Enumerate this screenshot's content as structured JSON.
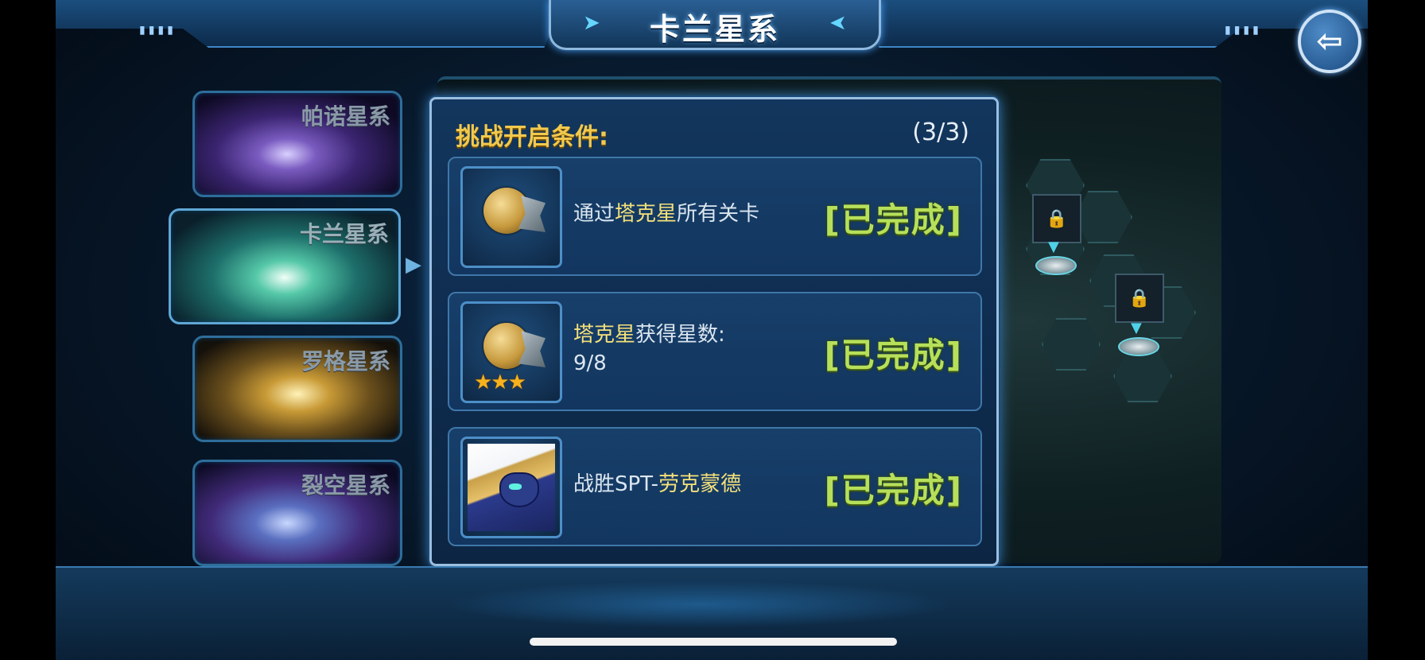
{
  "header": {
    "title": "卡兰星系"
  },
  "galaxies": [
    {
      "name": "帕诺星系"
    },
    {
      "name": "卡兰星系"
    },
    {
      "name": "罗格星系"
    },
    {
      "name": "裂空星系"
    }
  ],
  "dialog": {
    "title": "挑战开启条件:",
    "count": "(3/3)",
    "conditions": [
      {
        "prefix": "通过",
        "highlight": "塔克星",
        "suffix": "所有关卡",
        "status": "[已完成]",
        "icon": "planet-icon"
      },
      {
        "highlight": "塔克星",
        "suffix": "获得星数:",
        "line2": "9/8",
        "status": "[已完成]",
        "icon": "planet-stars-icon"
      },
      {
        "prefix": "战胜SPT-",
        "highlight": "劳克蒙德",
        "status": "[已完成]",
        "icon": "boss-portrait-icon"
      }
    ]
  },
  "colors": {
    "accent_gold": "#f2c94c",
    "done_green": "#b7e05a",
    "highlight": "#f4e07a"
  }
}
